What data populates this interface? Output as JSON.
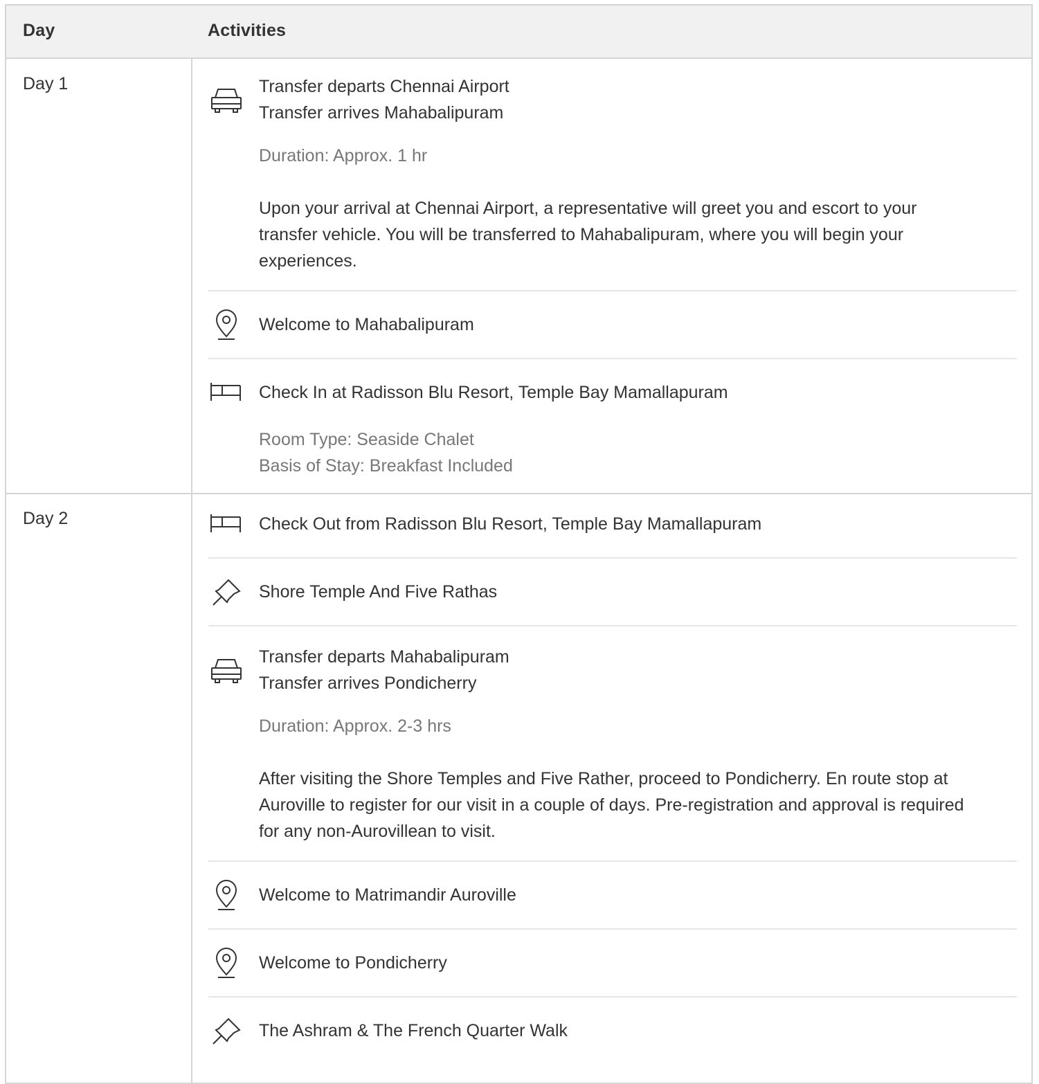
{
  "header": {
    "day": "Day",
    "activities": "Activities"
  },
  "days": [
    {
      "label": "Day 1",
      "items": [
        {
          "icon": "car-icon",
          "line1": "Transfer departs Chennai Airport",
          "line2": "Transfer arrives Mahabalipuram",
          "duration": "Duration: Approx. 1 hr",
          "description": "Upon your arrival at Chennai Airport, a representative will greet you and escort to your transfer vehicle.  You will be transferred to Mahabalipuram, where you will begin your experiences."
        },
        {
          "icon": "location-pin-icon",
          "title": "Welcome to Mahabalipuram"
        },
        {
          "icon": "bed-icon",
          "title": "Check In at Radisson Blu Resort, Temple Bay Mamallapuram",
          "room_type": "Room Type: Seaside Chalet",
          "basis": "Basis of Stay: Breakfast Included"
        }
      ]
    },
    {
      "label": "Day 2",
      "items": [
        {
          "icon": "bed-icon",
          "title": "Check Out from Radisson Blu Resort, Temple Bay Mamallapuram"
        },
        {
          "icon": "pushpin-icon",
          "title": "Shore Temple And Five Rathas"
        },
        {
          "icon": "car-icon",
          "line1": "Transfer departs Mahabalipuram",
          "line2": "Transfer arrives Pondicherry",
          "duration": "Duration: Approx. 2-3 hrs",
          "description": "After visiting the Shore Temples and Five Rather, proceed to Pondicherry.  En route stop at Auroville to register for our visit in a couple of days. Pre-registration and approval is required for any non-Aurovillean to visit."
        },
        {
          "icon": "location-pin-icon",
          "title": "Welcome to Matrimandir Auroville"
        },
        {
          "icon": "location-pin-icon",
          "title": "Welcome to Pondicherry"
        },
        {
          "icon": "pushpin-icon",
          "title": "The Ashram & The French Quarter Walk"
        }
      ]
    }
  ]
}
